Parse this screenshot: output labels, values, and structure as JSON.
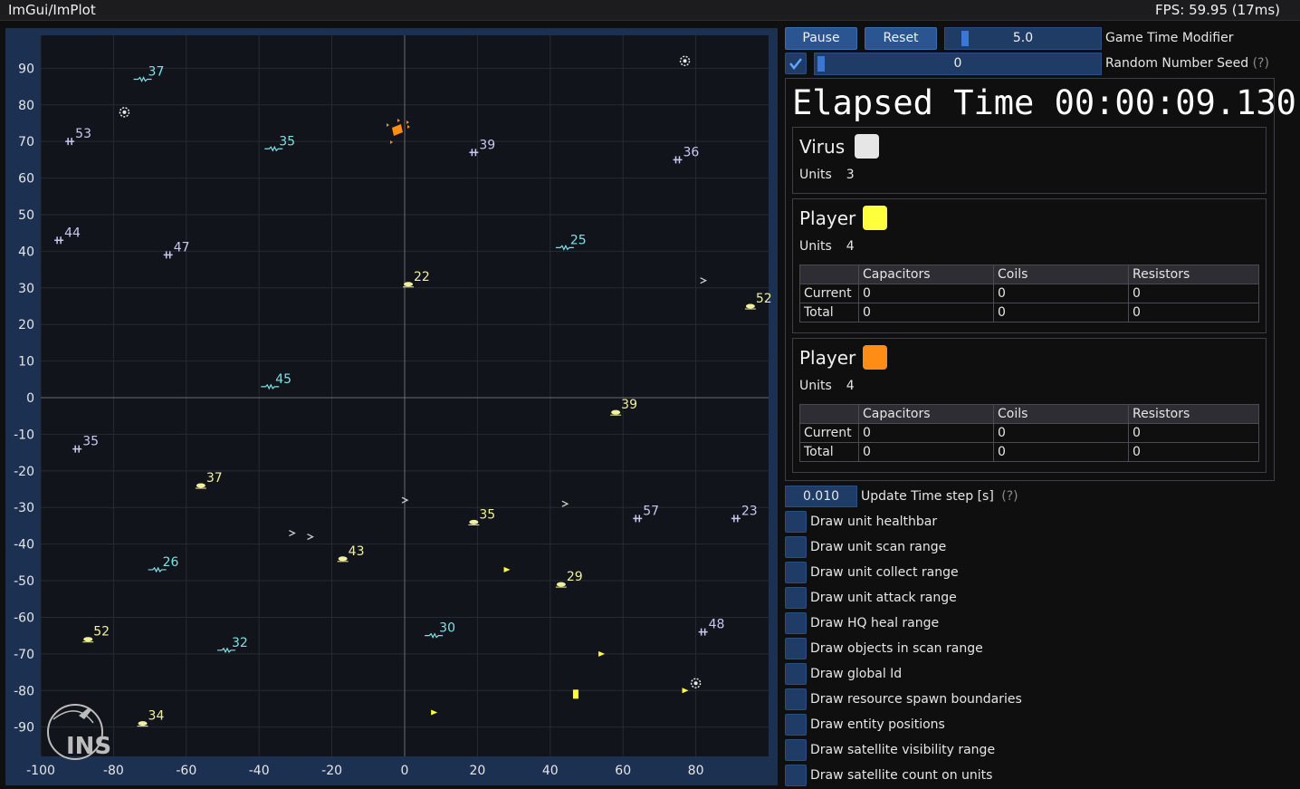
{
  "window": {
    "title": "ImGui/ImPlot",
    "fps": "FPS: 59.95 (17ms)"
  },
  "controls": {
    "pause": "Pause",
    "reset": "Reset",
    "game_time_value": "5.0",
    "game_time_label": "Game Time Modifier",
    "seed_value": "0",
    "seed_label": "Random Number Seed",
    "help": "(?)"
  },
  "elapsed": "Elapsed Time 00:00:09.130",
  "factions": [
    {
      "name": "Virus",
      "color": "#e6e6e6",
      "units_label": "Units",
      "units": "3"
    },
    {
      "name": "Player",
      "color": "#ffff3c",
      "units_label": "Units",
      "units": "4",
      "table": {
        "headers": [
          "",
          "Capacitors",
          "Coils",
          "Resistors"
        ],
        "rows": [
          [
            "Current",
            "0",
            "0",
            "0"
          ],
          [
            "Total",
            "0",
            "0",
            "0"
          ]
        ]
      }
    },
    {
      "name": "Player",
      "color": "#ff8c14",
      "units_label": "Units",
      "units": "4",
      "table": {
        "headers": [
          "",
          "Capacitors",
          "Coils",
          "Resistors"
        ],
        "rows": [
          [
            "Current",
            "0",
            "0",
            "0"
          ],
          [
            "Total",
            "0",
            "0",
            "0"
          ]
        ]
      }
    }
  ],
  "timestep": {
    "value": "0.010",
    "label": "Update Time step [s]",
    "help": "(?)"
  },
  "options": [
    "Draw unit healthbar",
    "Draw unit scan range",
    "Draw unit collect range",
    "Draw unit attack range",
    "Draw HQ heal range",
    "Draw objects in scan range",
    "Draw global Id",
    "Draw resource spawn boundaries",
    "Draw entity positions",
    "Draw satellite visibility range",
    "Draw satellite count on units"
  ],
  "logo_text": "INS",
  "chart_data": {
    "type": "scatter",
    "xlim": [
      -100,
      100
    ],
    "ylim": [
      -98,
      99
    ],
    "x_ticks": [
      -100,
      -80,
      -60,
      -40,
      -20,
      0,
      20,
      40,
      60,
      80
    ],
    "y_ticks": [
      90,
      80,
      70,
      60,
      50,
      40,
      30,
      20,
      10,
      0,
      -10,
      -20,
      -30,
      -40,
      -50,
      -60,
      -70,
      -80,
      -90
    ],
    "grid": true,
    "colors": {
      "lavender": "#c8c8f0",
      "cyan": "#7fe0e6",
      "yellow": "#f0f0a0",
      "orange": "#ff8c14",
      "bright_yellow": "#ffff3c",
      "white": "#e6e6e6"
    },
    "resources": [
      {
        "x": -92,
        "y": 70,
        "label": "53",
        "kind": "coil",
        "color": "lavender"
      },
      {
        "x": -95,
        "y": 43,
        "label": "44",
        "kind": "coil",
        "color": "lavender"
      },
      {
        "x": -65,
        "y": 39,
        "label": "47",
        "kind": "coil",
        "color": "lavender"
      },
      {
        "x": -90,
        "y": -14,
        "label": "35",
        "kind": "coil",
        "color": "lavender"
      },
      {
        "x": 19,
        "y": 67,
        "label": "39",
        "kind": "coil",
        "color": "lavender"
      },
      {
        "x": 75,
        "y": 65,
        "label": "36",
        "kind": "coil",
        "color": "lavender"
      },
      {
        "x": 64,
        "y": -33,
        "label": "57",
        "kind": "coil",
        "color": "lavender"
      },
      {
        "x": 91,
        "y": -33,
        "label": "23",
        "kind": "coil",
        "color": "lavender"
      },
      {
        "x": 82,
        "y": -64,
        "label": "48",
        "kind": "coil",
        "color": "lavender"
      },
      {
        "x": -72,
        "y": 87,
        "label": "37",
        "kind": "resistor",
        "color": "cyan"
      },
      {
        "x": -36,
        "y": 68,
        "label": "35",
        "kind": "resistor",
        "color": "cyan"
      },
      {
        "x": -37,
        "y": 3,
        "label": "45",
        "kind": "resistor",
        "color": "cyan"
      },
      {
        "x": 44,
        "y": 41,
        "label": "25",
        "kind": "resistor",
        "color": "cyan"
      },
      {
        "x": -68,
        "y": -47,
        "label": "26",
        "kind": "resistor",
        "color": "cyan"
      },
      {
        "x": -49,
        "y": -69,
        "label": "32",
        "kind": "resistor",
        "color": "cyan"
      },
      {
        "x": 8,
        "y": -65,
        "label": "30",
        "kind": "resistor",
        "color": "cyan"
      },
      {
        "x": 1,
        "y": 31,
        "label": "22",
        "kind": "capacitor",
        "color": "yellow"
      },
      {
        "x": 95,
        "y": 25,
        "label": "52",
        "kind": "capacitor",
        "color": "yellow"
      },
      {
        "x": 58,
        "y": -4,
        "label": "39",
        "kind": "capacitor",
        "color": "yellow"
      },
      {
        "x": -56,
        "y": -24,
        "label": "37",
        "kind": "capacitor",
        "color": "yellow"
      },
      {
        "x": 19,
        "y": -34,
        "label": "35",
        "kind": "capacitor",
        "color": "yellow"
      },
      {
        "x": -17,
        "y": -44,
        "label": "43",
        "kind": "capacitor",
        "color": "yellow"
      },
      {
        "x": 43,
        "y": -51,
        "label": "29",
        "kind": "capacitor",
        "color": "yellow"
      },
      {
        "x": -87,
        "y": -66,
        "label": "52",
        "kind": "capacitor",
        "color": "yellow"
      },
      {
        "x": -72,
        "y": -89,
        "label": "34",
        "kind": "capacitor",
        "color": "yellow"
      }
    ],
    "virus_units": [
      {
        "x": -77,
        "y": 78
      },
      {
        "x": 77,
        "y": 92
      },
      {
        "x": 80,
        "y": -78
      }
    ],
    "debris": [
      {
        "x": 82,
        "y": 32
      },
      {
        "x": 0,
        "y": -28
      },
      {
        "x": 44,
        "y": -29
      },
      {
        "x": -31,
        "y": -37
      },
      {
        "x": -26,
        "y": -38
      }
    ],
    "orange_units": [
      {
        "x": -2,
        "y": 73
      }
    ],
    "yellow_units": [
      {
        "x": 47,
        "y": -81
      },
      {
        "x": 28,
        "y": -47
      },
      {
        "x": 54,
        "y": -70
      },
      {
        "x": 8,
        "y": -86
      },
      {
        "x": 77,
        "y": -80
      }
    ]
  }
}
